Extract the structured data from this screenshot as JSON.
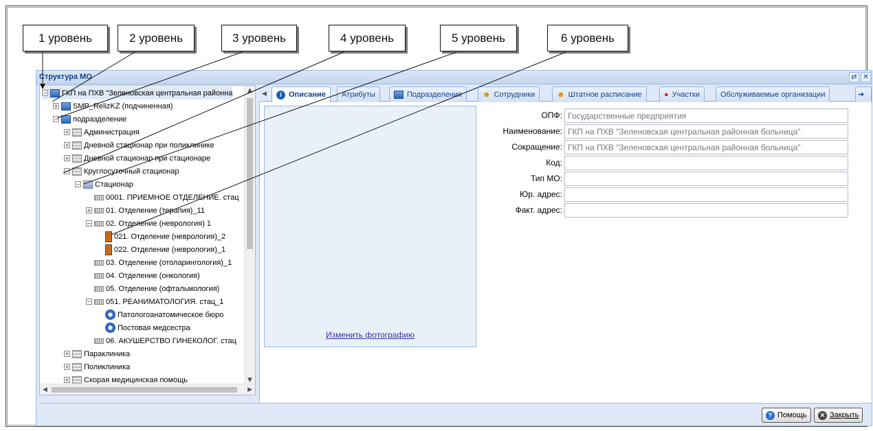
{
  "callouts": [
    {
      "label": "1 уровень"
    },
    {
      "label": "2 уровень"
    },
    {
      "label": "3 уровень"
    },
    {
      "label": "4 уровень"
    },
    {
      "label": "5 уровень"
    },
    {
      "label": "6 уровень"
    }
  ],
  "panel": {
    "title": "Структура МО",
    "tools": [
      "restore-icon",
      "close-icon"
    ]
  },
  "tree": {
    "nodes": [
      {
        "label": "ГКП на ПХВ \"Зеленовская центральная районна",
        "expander": "−",
        "icon": "org-icon",
        "selected": true
      },
      {
        "label": "SMP_RelizKZ (подчиненная)",
        "expander": "+",
        "icon": "org-icon"
      },
      {
        "label": "подразделение",
        "expander": "−",
        "icon": "org-icon"
      },
      {
        "label": "Администрация",
        "expander": "+",
        "icon": "building-icon"
      },
      {
        "label": "Дневной стационар при поликлинике",
        "expander": "+",
        "icon": "building-icon"
      },
      {
        "label": "Дневной стационар при стационаре",
        "expander": "+",
        "icon": "building-icon"
      },
      {
        "label": "Круглосуточный стационар",
        "expander": "−",
        "icon": "building-icon"
      },
      {
        "label": "Стационар",
        "expander": "−",
        "icon": "hospital-icon"
      },
      {
        "label": "0001. ПРИЕМНОЕ ОТДЕЛЕНИЕ. стац",
        "expander": "",
        "icon": "department-icon"
      },
      {
        "label": "01. Отделение (терапия)_11",
        "expander": "+",
        "icon": "department-icon"
      },
      {
        "label": "02. Отделение (неврология) 1",
        "expander": "−",
        "icon": "department-icon"
      },
      {
        "label": "021. Отделение (неврология)_2",
        "expander": "",
        "icon": "ward-icon"
      },
      {
        "label": "022. Отделение (неврология)_1",
        "expander": "",
        "icon": "ward-icon"
      },
      {
        "label": "03. Отделение (отоларингология)_1",
        "expander": "",
        "icon": "department-icon"
      },
      {
        "label": "04. Отделение (онкология)",
        "expander": "",
        "icon": "department-icon"
      },
      {
        "label": "05. Отделение (офтальмология)",
        "expander": "",
        "icon": "department-icon"
      },
      {
        "label": "051. РЕАНИМАТОЛОГИЯ. стац_1",
        "expander": "−",
        "icon": "department-icon"
      },
      {
        "label": "Патологоанатомическое бюро",
        "expander": "",
        "icon": "staff-icon"
      },
      {
        "label": "Постовая медсестра",
        "expander": "",
        "icon": "staff-icon"
      },
      {
        "label": "06. АКУШЕРСТВО ГИНЕКОЛОГ. стац",
        "expander": "",
        "icon": "department-icon"
      },
      {
        "label": "Параклиника",
        "expander": "+",
        "icon": "building-icon"
      },
      {
        "label": "Поликлиника",
        "expander": "+",
        "icon": "building-icon"
      },
      {
        "label": "Скорая медицинская помощь",
        "expander": "+",
        "icon": "building-icon"
      }
    ]
  },
  "tabs": [
    {
      "label": "Описание",
      "icon": "info-icon",
      "active": true
    },
    {
      "label": "Атрибуты",
      "icon": ""
    },
    {
      "label": "Подразделения",
      "icon": "org-icon"
    },
    {
      "label": "Сотрудники",
      "icon": "person-icon"
    },
    {
      "label": "Штатное расписание",
      "icon": "person-icon"
    },
    {
      "label": "Участки",
      "icon": "pin-icon"
    },
    {
      "label": "Обслуживаемые организации",
      "icon": ""
    }
  ],
  "photo": {
    "link_label": "Изменить фотографию"
  },
  "form": {
    "fields": [
      {
        "label": "ОПФ:",
        "value": "Государственные предприятия"
      },
      {
        "label": "Наименование:",
        "value": "ГКП на ПХВ \"Зеленовская центральная районная больница\""
      },
      {
        "label": "Сокращение:",
        "value": "ГКП на ПХВ \"Зеленовская центральная районная больница\""
      },
      {
        "label": "Код:",
        "value": ""
      },
      {
        "label": "Тип МО:",
        "value": ""
      },
      {
        "label": "Юр. адрес:",
        "value": ""
      },
      {
        "label": "Факт. адрес:",
        "value": ""
      }
    ]
  },
  "footer": {
    "help_label": "Помощь",
    "close_label": "Закрыть"
  },
  "colors": {
    "panel_bg": "#dfe8f6",
    "panel_border": "#99bbe8",
    "title_text": "#15428b",
    "link": "#3333aa"
  }
}
